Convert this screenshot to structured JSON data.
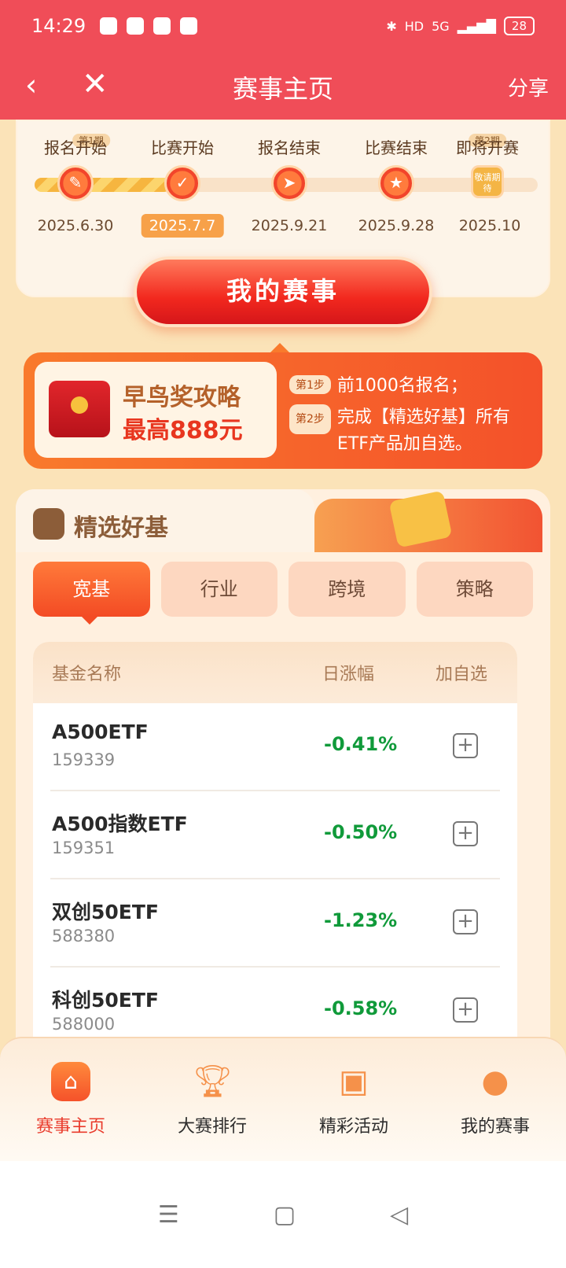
{
  "status_bar": {
    "time": "14:29",
    "network": "5G",
    "hd": "HD",
    "battery": "28",
    "icons": [
      "wechat-icon",
      "wallet-icon",
      "chat-bubble-icon",
      "paper-plane-icon",
      "bluetooth-icon",
      "signal-icon"
    ]
  },
  "nav": {
    "back_icon": "chevron-left-icon",
    "close_icon": "close-icon",
    "title": "赛事主页",
    "share": "分享"
  },
  "timeline": {
    "period_start": "第1期",
    "period_next": "第2期",
    "stages": [
      {
        "label": "报名开始",
        "date": "2025.6.30",
        "icon": "sign-up-icon"
      },
      {
        "label": "比赛开始",
        "date": "2025.7.7",
        "icon": "check-document-icon",
        "active": true
      },
      {
        "label": "报名结束",
        "date": "2025.9.21",
        "icon": "paper-plane-icon"
      },
      {
        "label": "比赛结束",
        "date": "2025.9.28",
        "icon": "trophy-icon"
      },
      {
        "label": "即将开赛",
        "date": "2025.10",
        "icon": "stay-tuned-badge",
        "badge_text": "敬请期待"
      }
    ],
    "progress": 0.27,
    "my_event_button": "我的赛事"
  },
  "early_bird": {
    "title": "早鸟奖攻略",
    "prize": "最高888元",
    "step1_badge": "第1步",
    "step1_text": "前1000名报名；",
    "step2_badge": "第2步",
    "step2_text": "完成【精选好基】所有ETF产品加自选。"
  },
  "fund_section": {
    "title": "精选好基",
    "tabs": [
      "宽基",
      "行业",
      "跨境",
      "策略"
    ],
    "active_tab": 0,
    "columns": [
      "基金名称",
      "日涨幅",
      "加自选"
    ],
    "rows": [
      {
        "name": "A500ETF",
        "code": "159339",
        "change": "-0.41%"
      },
      {
        "name": "A500指数ETF",
        "code": "159351",
        "change": "-0.50%"
      },
      {
        "name": "双创50ETF",
        "code": "588380",
        "change": "-1.23%"
      },
      {
        "name": "科创50ETF",
        "code": "588000",
        "change": "-0.58%"
      }
    ],
    "change_color": "#109a3a"
  },
  "bottom_tabs": [
    {
      "label": "赛事主页",
      "icon": "home-icon",
      "active": true
    },
    {
      "label": "大赛排行",
      "icon": "trophy-icon"
    },
    {
      "label": "精彩活动",
      "icon": "gift-icon"
    },
    {
      "label": "我的赛事",
      "icon": "user-icon"
    }
  ],
  "system_nav": [
    "menu-icon",
    "home-square-icon",
    "back-triangle-icon"
  ],
  "colors": {
    "header": "#f04d58",
    "accent": "#f34b24",
    "background": "#fbe3b8"
  }
}
